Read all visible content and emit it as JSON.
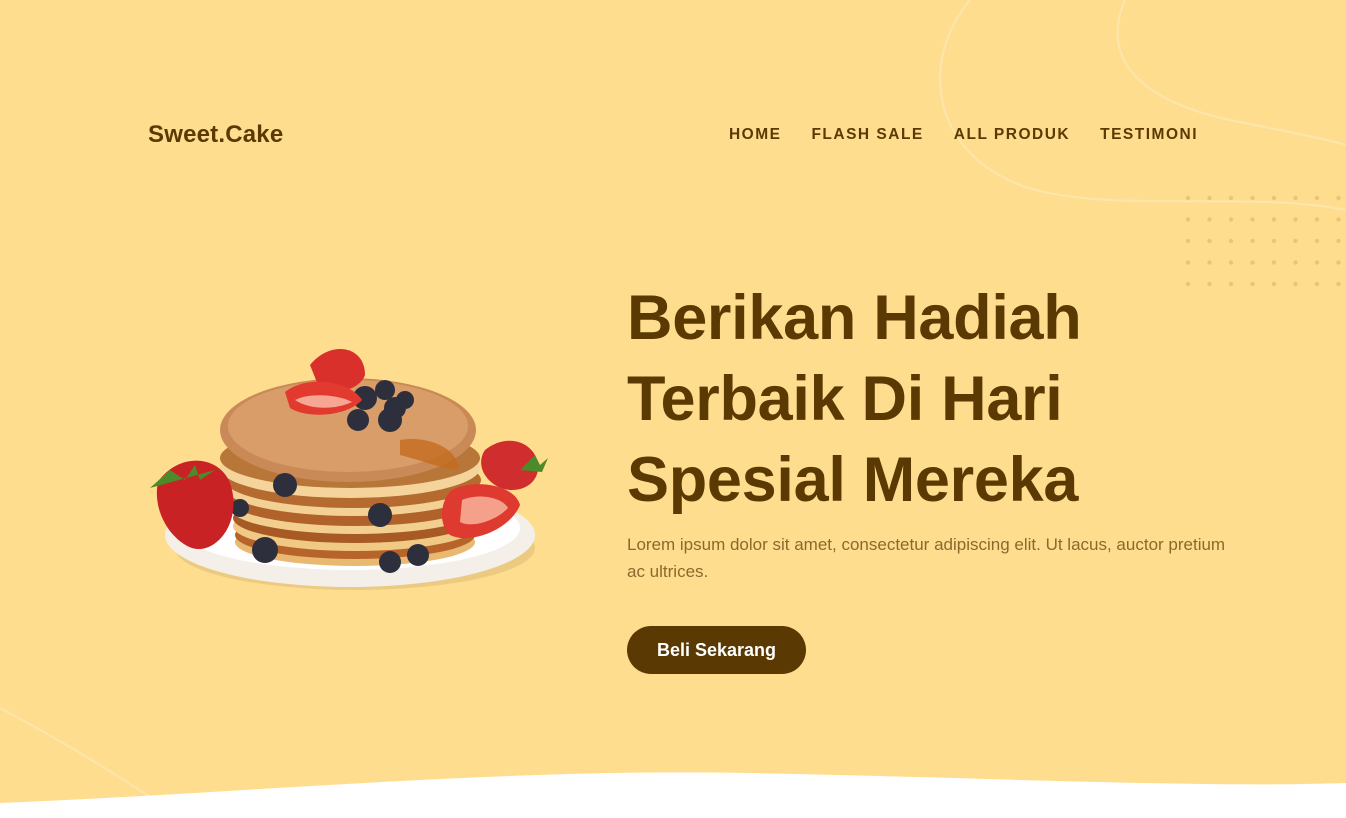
{
  "brand": {
    "logo": "Sweet.Cake"
  },
  "nav": {
    "items": [
      {
        "label": "HOME"
      },
      {
        "label": "FLASH SALE"
      },
      {
        "label": "ALL PRODUK"
      },
      {
        "label": "TESTIMONI"
      }
    ]
  },
  "hero": {
    "headline_lines": [
      "Berikan Hadiah",
      "Terbaik Di Hari",
      "Spesial Mereka"
    ],
    "description": "Lorem ipsum dolor sit amet, consectetur adipiscing elit. Ut lacus, auctor pretium ac ultrices.",
    "cta_label": "Beli Sekarang",
    "image_icon": "pancake-stack-image"
  },
  "colors": {
    "background": "#ffdd8f",
    "primary": "#5a3a02",
    "text_muted": "#8a6a2c",
    "white": "#ffffff"
  }
}
